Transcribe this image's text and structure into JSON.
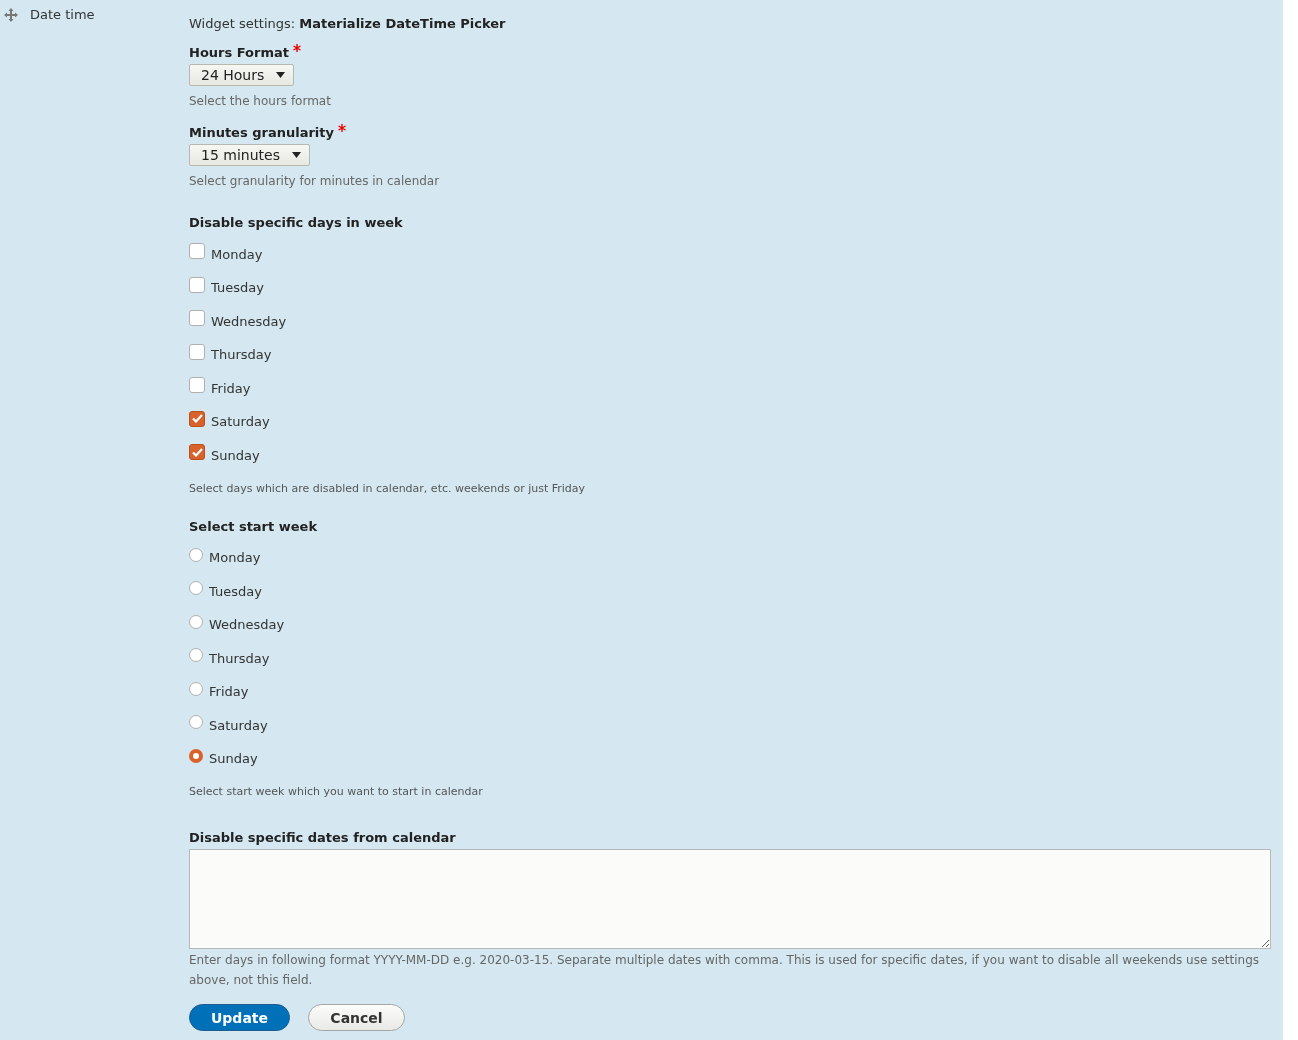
{
  "row_label": "Date time",
  "widget_settings": {
    "prefix": "Widget settings:",
    "name": "Materialize DateTime Picker"
  },
  "selects": [
    {
      "label": "Hours Format",
      "required": true,
      "value": "24 Hours",
      "description": "Select the hours format"
    },
    {
      "label": "Minutes granularity",
      "required": true,
      "value": "15 minutes",
      "description": "Select granularity for minutes in calendar"
    }
  ],
  "disabled_days": {
    "heading": "Disable specific days in week",
    "options": [
      {
        "label": "Monday",
        "checked": false
      },
      {
        "label": "Tuesday",
        "checked": false
      },
      {
        "label": "Wednesday",
        "checked": false
      },
      {
        "label": "Thursday",
        "checked": false
      },
      {
        "label": "Friday",
        "checked": false
      },
      {
        "label": "Saturday",
        "checked": true
      },
      {
        "label": "Sunday",
        "checked": true
      }
    ],
    "description": "Select days which are disabled in calendar, etc. weekends or just Friday"
  },
  "start_week": {
    "heading": "Select start week",
    "options": [
      {
        "label": "Monday",
        "selected": false
      },
      {
        "label": "Tuesday",
        "selected": false
      },
      {
        "label": "Wednesday",
        "selected": false
      },
      {
        "label": "Thursday",
        "selected": false
      },
      {
        "label": "Friday",
        "selected": false
      },
      {
        "label": "Saturday",
        "selected": false
      },
      {
        "label": "Sunday",
        "selected": true
      }
    ],
    "description": "Select start week which you want to start in calendar"
  },
  "disabled_dates": {
    "label": "Disable specific dates from calendar",
    "description": "Enter days in following format YYYY-MM-DD e.g. 2020-03-15. Separate multiple dates with comma. This is used for specific dates, if you want to disable all weekends use settings above, not this field."
  },
  "buttons": [
    {
      "label": "Update",
      "kind": "primary"
    },
    {
      "label": "Cancel",
      "kind": "secondary"
    }
  ]
}
